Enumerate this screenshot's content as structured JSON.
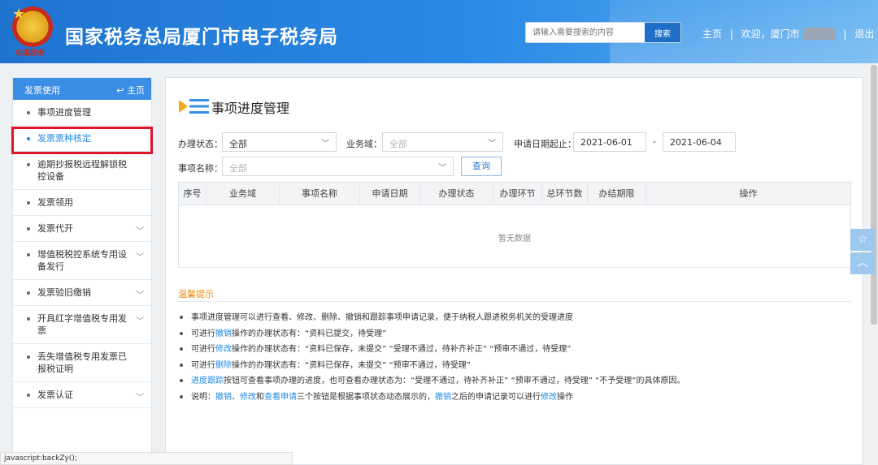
{
  "header": {
    "emblem_text": "中国税务",
    "site_title": "国家税务总局厦门市电子税务局",
    "search_placeholder": "请输入需要搜索的内容",
    "search_button": "搜索",
    "nav_home": "主页",
    "sep": "|",
    "welcome": "欢迎，厦门市",
    "logout": "退出"
  },
  "sidebar": {
    "header_title": "发票使用",
    "home_label": "主页",
    "items": [
      {
        "label": "事项进度管理"
      },
      {
        "label": "发票票种核定"
      },
      {
        "label": "逾期抄报税远程解锁税控设备"
      },
      {
        "label": "发票领用"
      },
      {
        "label": "发票代开"
      },
      {
        "label": "增值税税控系统专用设备发行"
      },
      {
        "label": "发票验旧缴销"
      },
      {
        "label": "开具红字增值税专用发票"
      },
      {
        "label": "丢失增值税专用发票已报税证明"
      },
      {
        "label": "发票认证"
      }
    ]
  },
  "main": {
    "page_title": "事项进度管理",
    "filters": {
      "status_label": "办理状态：",
      "status_value": "全部",
      "domain_label": "业务域：",
      "domain_placeholder": "全部",
      "date_label": "申请日期起止：",
      "date_start": "2021-06-01",
      "date_sep": "-",
      "date_end": "2021-06-04",
      "item_label": "事项名称：",
      "item_placeholder": "全部",
      "query_button": "查询"
    },
    "table": {
      "columns": [
        "序号",
        "业务域",
        "事项名称",
        "申请日期",
        "办理状态",
        "办理环节",
        "总环节数",
        "办结期限",
        "操作"
      ],
      "empty_text": "暂无数据"
    },
    "tips": {
      "title": "温馨提示",
      "t1": "事项进度管理可以进行查看、修改、删除、撤销和跟踪事项申请记录，便于纳税人跟进税务机关的受理进度",
      "t2_pre": "可进行",
      "t2_link": "撤销",
      "t2_post": "操作的办理状态有：“资料已提交，待受理”",
      "t3_pre": "可进行",
      "t3_link": "修改",
      "t3_post": "操作的办理状态有：“资料已保存，未提交”  “受理不通过，待补齐补正”  “预审不通过，待受理”",
      "t4_pre": "可进行",
      "t4_link": "删除",
      "t4_post": "操作的办理状态有：“资料已保存，未提交”  “预审不通过，待受理”",
      "t5_link": "进度跟踪",
      "t5_post": "按钮可查看事项办理的进度，也可查看办理状态为：“受理不通过，待补齐补正”  “预审不通过，待受理”  “不予受理”的具体原因。",
      "t6_pre": "说明：",
      "t6_l1": "撤销",
      "t6_s1": "、",
      "t6_l2": "修改",
      "t6_s2": "和",
      "t6_l3": "查看申请",
      "t6_mid": "三个按钮是根据事项状态动态展示的，",
      "t6_l4": "撤销",
      "t6_mid2": "之后的申请记录可以进行",
      "t6_l5": "修改",
      "t6_end": "操作"
    }
  },
  "status_bar": "javascript:backZy();",
  "colors": {
    "header": "#1f74d0",
    "accent": "#3a8ee6",
    "highlight": "#e0142b",
    "tips_title": "#f08c00",
    "link": "#1f88e5"
  },
  "icons": {
    "favorite": "star-icon",
    "back_top": "chevron-up-icon",
    "home": "back-arrow-icon"
  }
}
